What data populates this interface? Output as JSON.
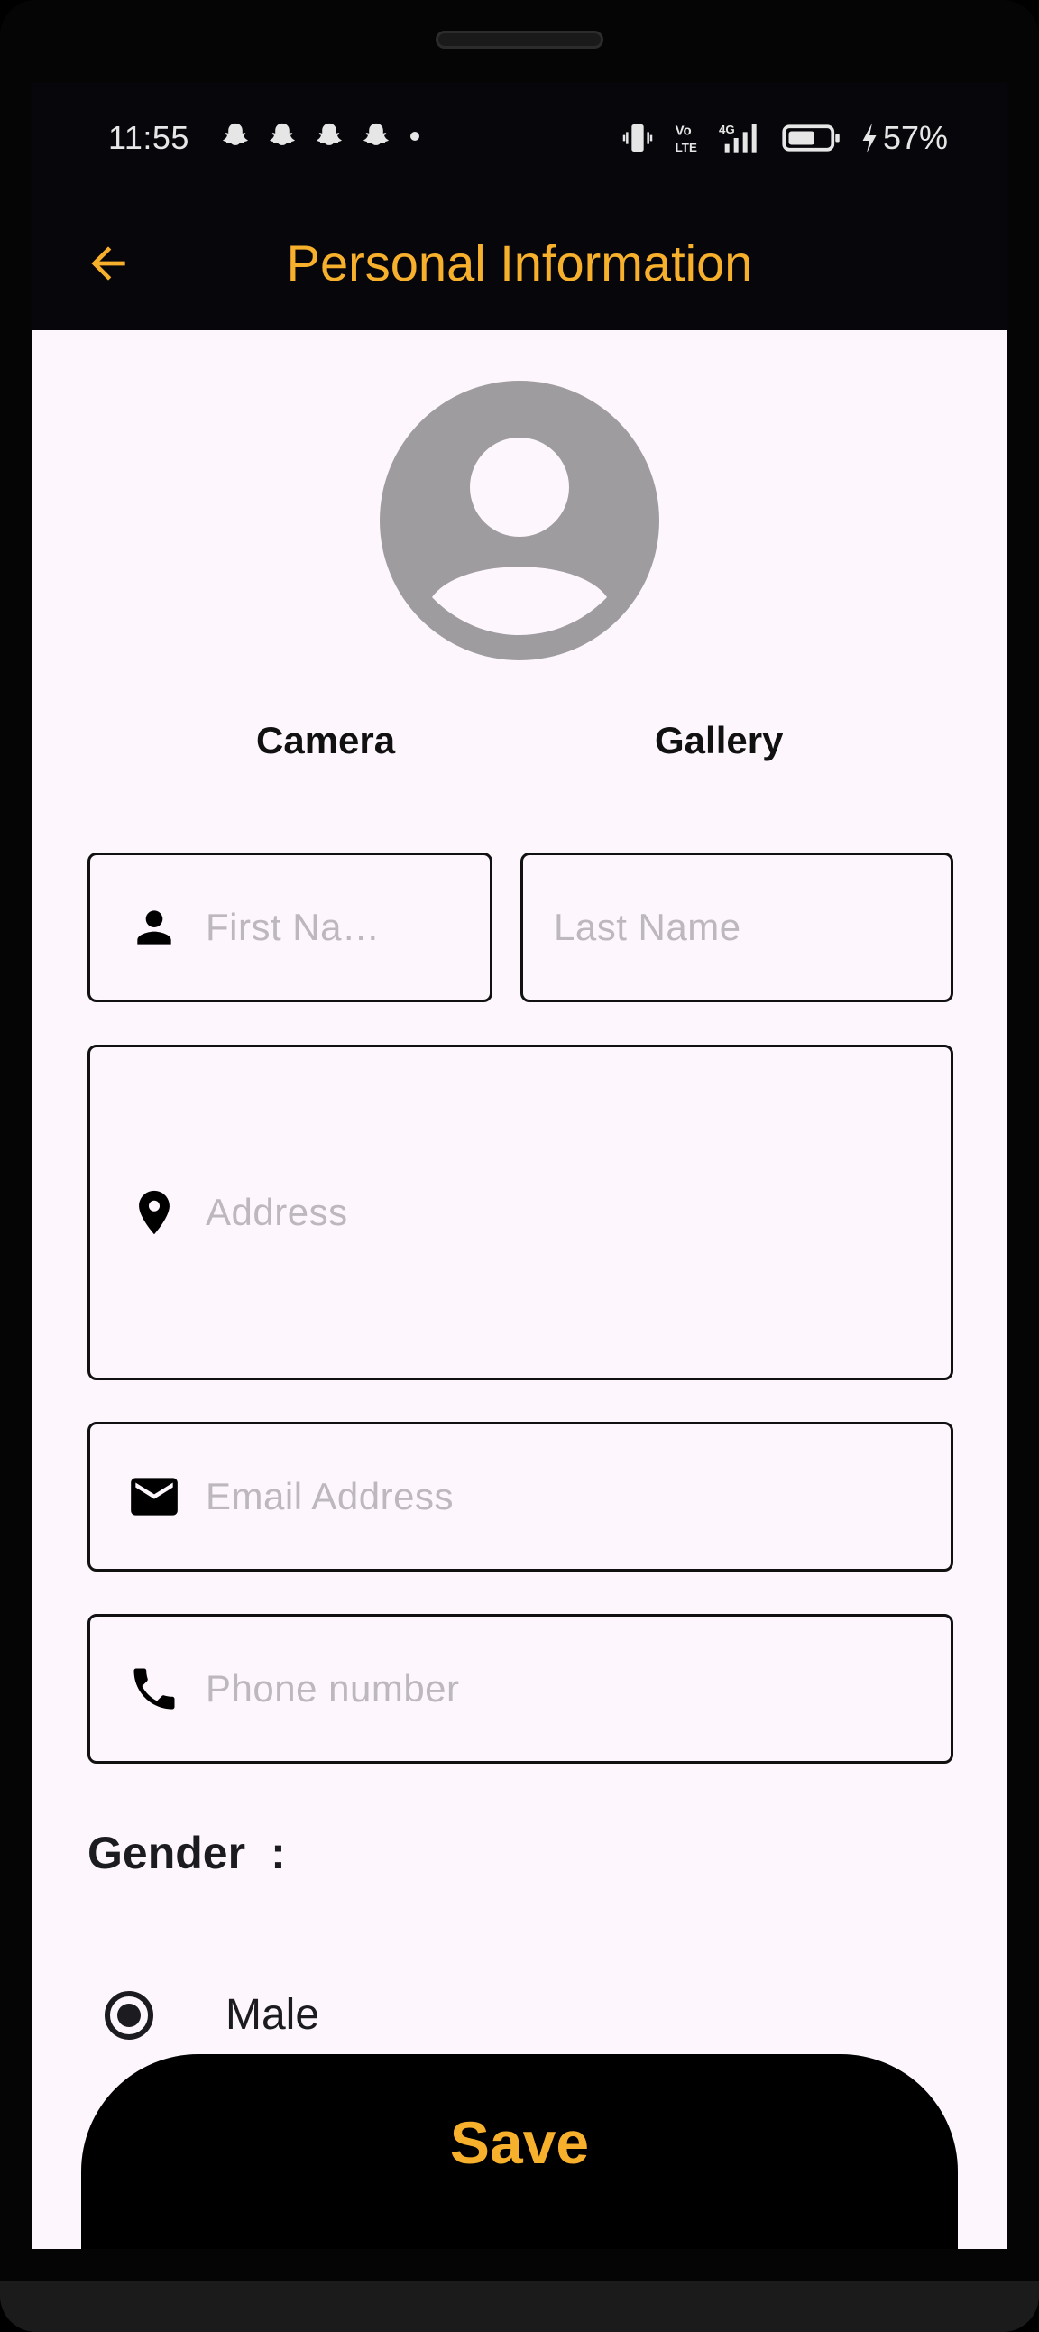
{
  "status_bar": {
    "time": "11:55",
    "battery_percent": "57%",
    "notification_icons": [
      "snapchat-icon",
      "snapchat-icon",
      "snapchat-icon",
      "snapchat-icon",
      "dot-icon"
    ],
    "indicators": [
      "vibrate-icon",
      "volte-icon",
      "4g-signal-icon",
      "battery-icon",
      "charging-icon"
    ]
  },
  "app_bar": {
    "title": "Personal Information",
    "back_icon": "arrow-left-icon",
    "accent_color": "#f7b02c",
    "background_color": "#07060b"
  },
  "profile": {
    "avatar_icon": "account-circle-icon",
    "camera_label": "Camera",
    "gallery_label": "Gallery"
  },
  "form": {
    "first_name": {
      "placeholder": "First Na…",
      "icon": "person-icon"
    },
    "last_name": {
      "placeholder": "Last Name"
    },
    "address": {
      "placeholder": "Address",
      "icon": "location-pin-icon"
    },
    "email": {
      "placeholder": "Email Address",
      "icon": "mail-icon"
    },
    "phone": {
      "placeholder": "Phone number",
      "icon": "phone-icon"
    }
  },
  "gender": {
    "label": "Gender",
    "colon": ":",
    "options": [
      {
        "label": "Male",
        "selected": true
      }
    ]
  },
  "save_button": {
    "label": "Save"
  }
}
